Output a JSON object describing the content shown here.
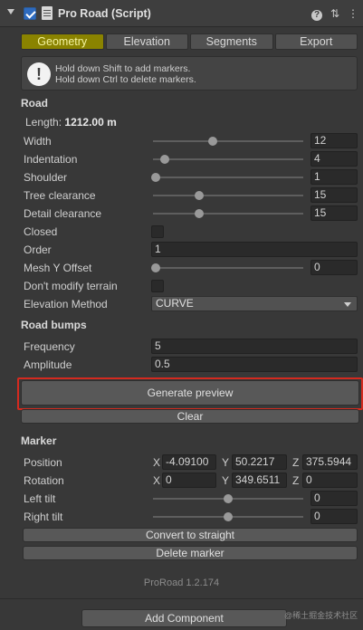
{
  "header": {
    "title": "Pro Road (Script)",
    "help_icon": "help-icon",
    "presets_icon": "presets-icon",
    "menu_icon": "kebab-menu-icon"
  },
  "tabs": [
    {
      "label": "Geometry",
      "active": true
    },
    {
      "label": "Elevation",
      "active": false
    },
    {
      "label": "Segments",
      "active": false
    },
    {
      "label": "Export",
      "active": false
    }
  ],
  "help": {
    "icon": "!",
    "line1": "Hold down Shift to add markers.",
    "line2": "Hold down Ctrl to delete markers."
  },
  "road": {
    "section_label": "Road",
    "length_label": "Length:",
    "length_value": "1212.00 m",
    "width": {
      "label": "Width",
      "value": "12",
      "fill": 0.4
    },
    "indentation": {
      "label": "Indentation",
      "value": "4",
      "fill": 0.08
    },
    "shoulder": {
      "label": "Shoulder",
      "value": "1",
      "fill": 0.02
    },
    "tree_clearance": {
      "label": "Tree clearance",
      "value": "15",
      "fill": 0.31
    },
    "detail_clearance": {
      "label": "Detail clearance",
      "value": "15",
      "fill": 0.31
    },
    "closed_label": "Closed",
    "order": {
      "label": "Order",
      "value": "1"
    },
    "mesh_y_offset": {
      "label": "Mesh Y Offset",
      "value": "0",
      "fill": 0.02
    },
    "dont_modify_terrain_label": "Don't modify terrain",
    "elevation_method": {
      "label": "Elevation Method",
      "value": "CURVE"
    }
  },
  "bumps": {
    "section_label": "Road bumps",
    "frequency": {
      "label": "Frequency",
      "value": "5"
    },
    "amplitude": {
      "label": "Amplitude",
      "value": "0.5"
    }
  },
  "buttons": {
    "generate_preview": "Generate preview",
    "clear": "Clear",
    "convert": "Convert to straight",
    "delete": "Delete marker",
    "add_component": "Add Component"
  },
  "marker": {
    "section_label": "Marker",
    "position": {
      "label": "Position",
      "x": "-4.09100",
      "y": "50.2217",
      "z": "375.5944"
    },
    "rotation": {
      "label": "Rotation",
      "x": "0",
      "y": "349.6511",
      "z": "0"
    },
    "axis_x": "X",
    "axis_y": "Y",
    "axis_z": "Z",
    "left_tilt": {
      "label": "Left tilt",
      "value": "0",
      "fill": 0.5
    },
    "right_tilt": {
      "label": "Right tilt",
      "value": "0",
      "fill": 0.5
    }
  },
  "version": "ProRoad 1.2.174",
  "watermark": "@稀土掘金技术社区",
  "colors": {
    "active_tab": "#8a8300",
    "highlight": "#d42a1f",
    "background": "#383838"
  }
}
